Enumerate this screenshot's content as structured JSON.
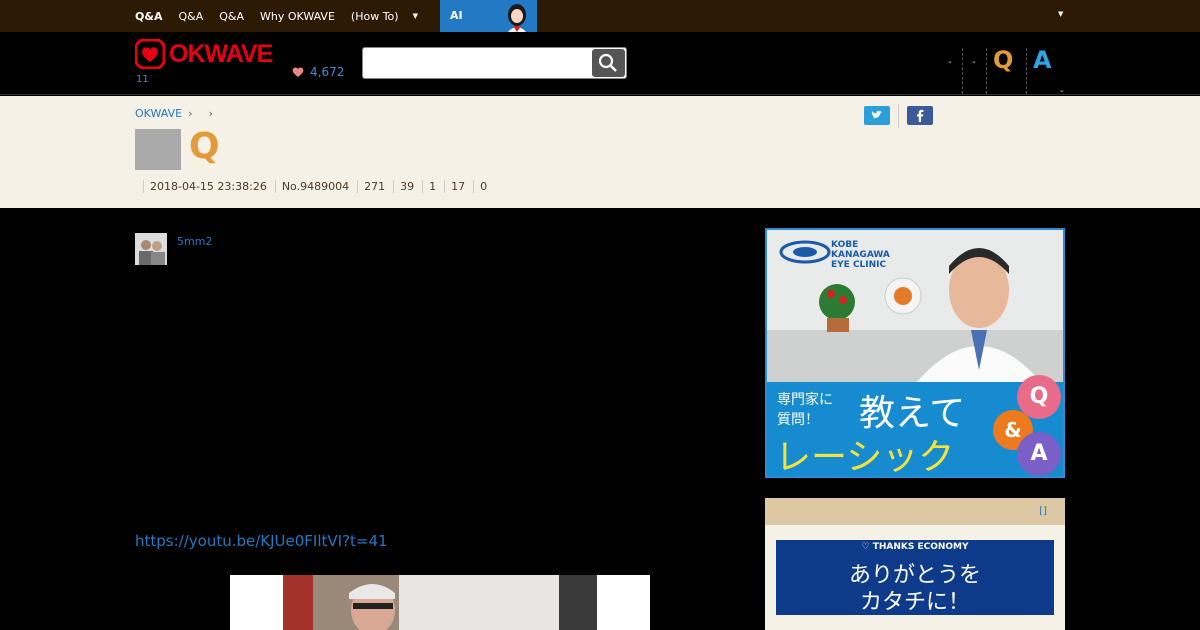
{
  "topnav": {
    "items": [
      "Q&A",
      "Q&A",
      "Q&A",
      "Why OKWAVE",
      "(How To)"
    ],
    "ai_label": "AI"
  },
  "header": {
    "logo_text": "OKWAVE",
    "logo_sub": "11",
    "thanks_count": "4,672",
    "search_placeholder": "",
    "q_label": "Q",
    "a_label": "A"
  },
  "question": {
    "breadcrumb": [
      "OKWAVE"
    ],
    "title_mark": "Q",
    "meta": [
      "2018-04-15 23:38:26",
      "No.9489004",
      "271",
      "39",
      "1",
      "17",
      "0"
    ]
  },
  "post": {
    "username": "5mm2",
    "link": "https://youtu.be/KJUe0FIltVI?t=41"
  },
  "ad": {
    "clinic_name": "KOBE\nKANAGAWA\nEYE CLINIC",
    "small_text_1": "専門家に",
    "small_text_2": "質問！",
    "big_text_1": "教えて",
    "big_text_2": "レーシック",
    "q": "Q",
    "amp": "&",
    "a": "A"
  },
  "panel": {
    "link": "[]",
    "thanks_title": "THANKS ECONOMY",
    "thanks_line1": "ありがとうを",
    "thanks_line2": "カタチに！"
  },
  "colors": {
    "topbar": "#2d1a05",
    "ai_button": "#2479c4",
    "logo": "#e60012",
    "question_accent": "#e29a3a",
    "answer_accent": "#2aa7e0",
    "link": "#2479c4"
  }
}
